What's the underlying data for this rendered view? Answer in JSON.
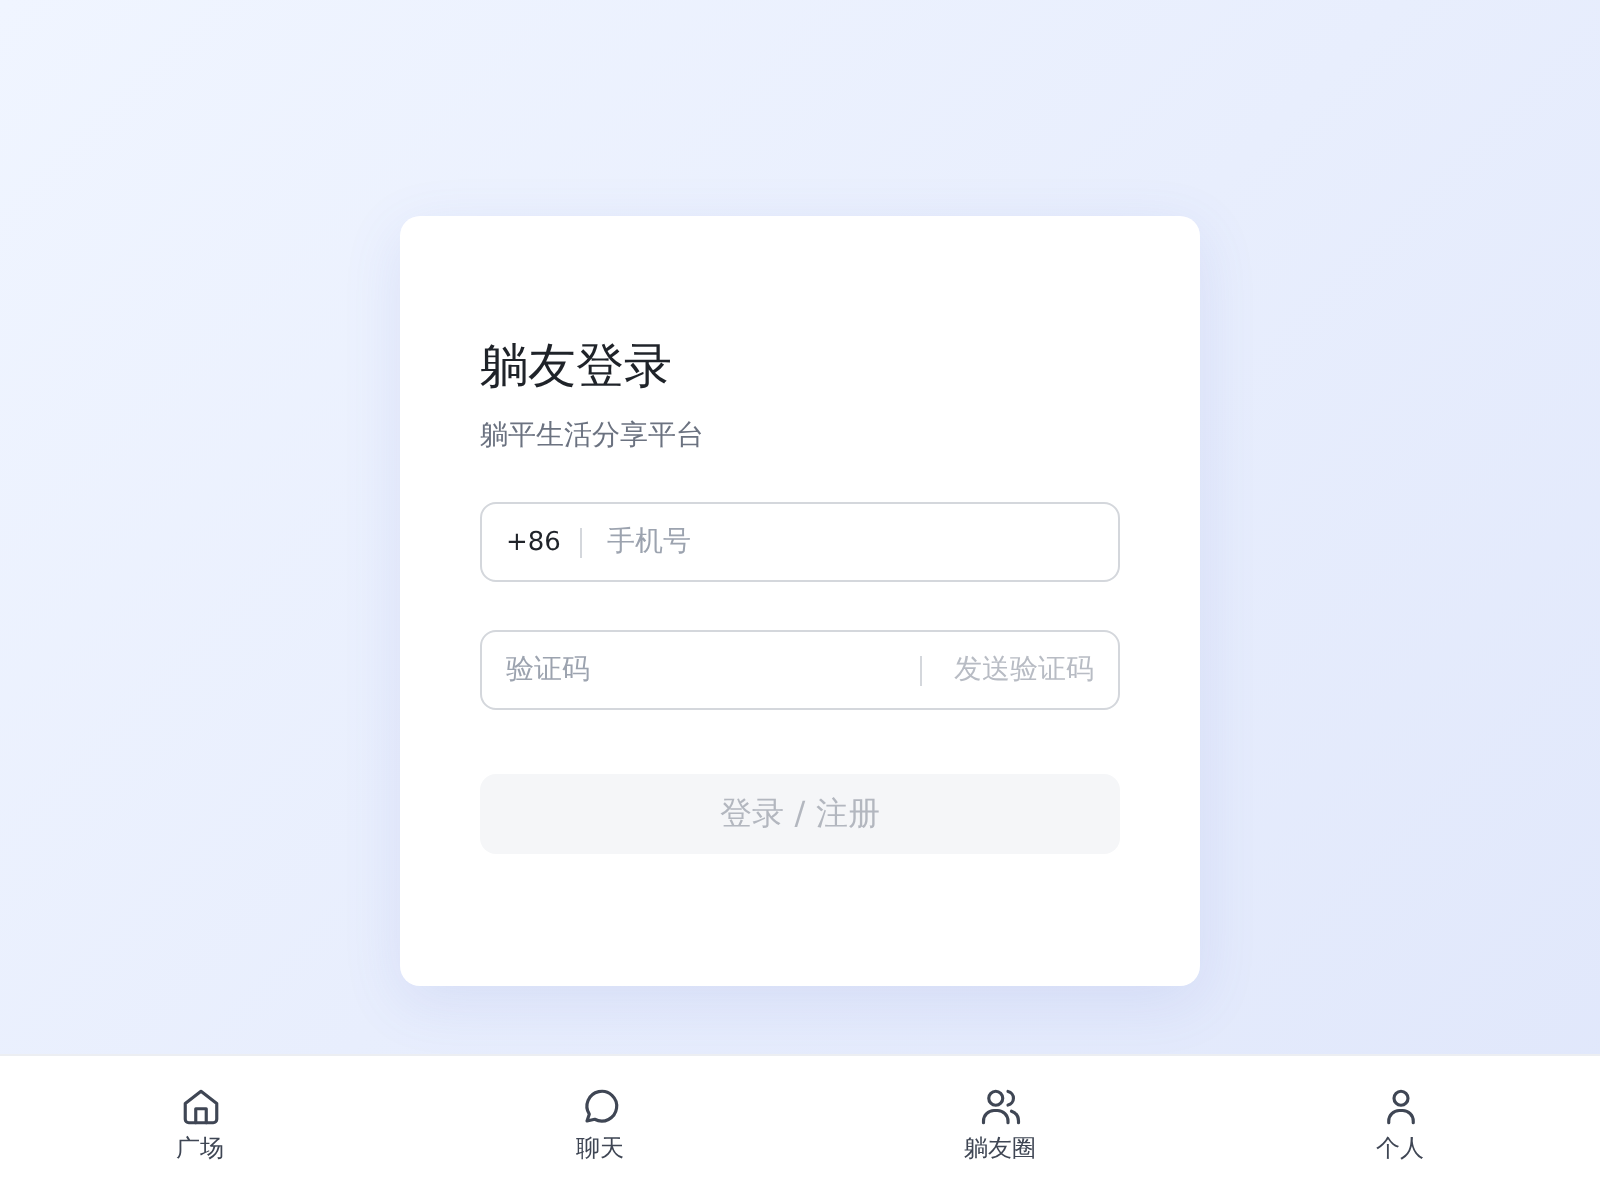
{
  "login": {
    "title": "躺友登录",
    "subtitle": "躺平生活分享平台",
    "phone": {
      "prefix": "+86",
      "placeholder": "手机号"
    },
    "code": {
      "placeholder": "验证码",
      "send_label": "发送验证码"
    },
    "submit": {
      "label": "登录 / 注册",
      "disabled": true
    }
  },
  "nav": [
    {
      "kind": "home",
      "label": "广场"
    },
    {
      "kind": "chat",
      "label": "聊天"
    },
    {
      "kind": "group",
      "label": "躺友圈"
    },
    {
      "kind": "person",
      "label": "个人"
    }
  ]
}
